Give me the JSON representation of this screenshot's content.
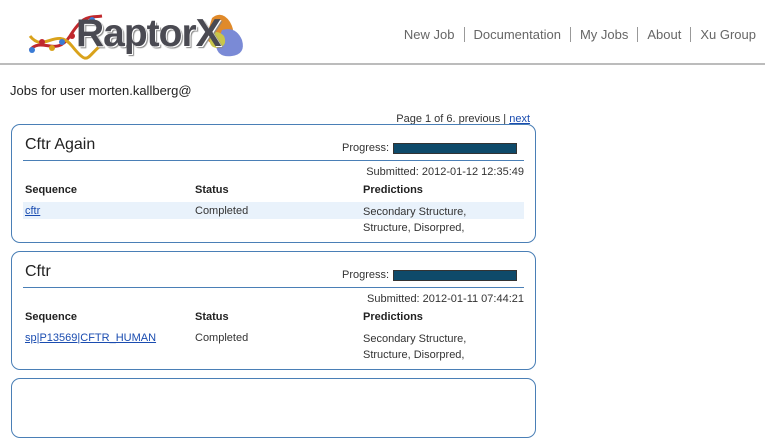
{
  "header": {
    "logo_text": "RaptorX",
    "nav": [
      "New Job",
      "Documentation",
      "My Jobs",
      "About",
      "Xu Group"
    ]
  },
  "jobs_title": "Jobs for user morten.kallberg@",
  "pager": {
    "text": "Page 1 of 6. previous | ",
    "next": "next"
  },
  "columns": {
    "sequence": "Sequence",
    "status": "Status",
    "predictions": "Predictions"
  },
  "progress_label": "Progress:",
  "jobs": [
    {
      "name": "Cftr Again",
      "progress": 1.0,
      "submitted": "Submitted: 2012-01-12 12:35:49",
      "sequence": "cftr",
      "status": "Completed",
      "predictions": "Secondary Structure, Structure, Disorpred,"
    },
    {
      "name": "Cftr",
      "progress": 1.0,
      "submitted": "Submitted: 2012-01-11 07:44:21",
      "sequence": "sp|P13569|CFTR_HUMAN",
      "status": "Completed",
      "predictions": "Secondary Structure, Structure, Disorpred,"
    }
  ]
}
